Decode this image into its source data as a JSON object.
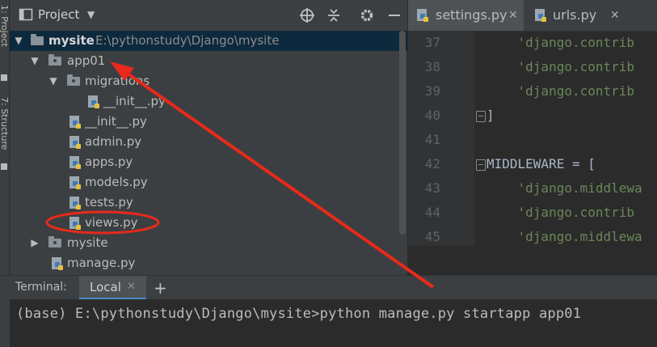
{
  "side_strip": {
    "tab_top": "1: Project",
    "tab_bottom": "7: Structure"
  },
  "project_panel": {
    "title": "Project",
    "header_icons": [
      "crosshair-icon",
      "collapse-icon",
      "gear-icon",
      "minimize-icon"
    ],
    "tree": [
      {
        "label": "mysite",
        "path": "E:\\pythonstudy\\Django\\mysite",
        "type": "folder",
        "expanded": true,
        "depth": 0
      },
      {
        "label": "app01",
        "type": "folder",
        "expanded": true,
        "depth": 1
      },
      {
        "label": "migrations",
        "type": "folder",
        "expanded": true,
        "depth": 2
      },
      {
        "label": "__init__.py",
        "type": "python-file",
        "depth": 3
      },
      {
        "label": "__init__.py",
        "type": "python-file",
        "depth": 2
      },
      {
        "label": "admin.py",
        "type": "python-file",
        "depth": 2
      },
      {
        "label": "apps.py",
        "type": "python-file",
        "depth": 2
      },
      {
        "label": "models.py",
        "type": "python-file",
        "depth": 2
      },
      {
        "label": "tests.py",
        "type": "python-file",
        "depth": 2
      },
      {
        "label": "views.py",
        "type": "python-file",
        "depth": 2
      },
      {
        "label": "mysite",
        "type": "folder",
        "expanded": false,
        "depth": 1
      },
      {
        "label": "manage.py",
        "type": "python-file",
        "depth": 1
      }
    ]
  },
  "editor": {
    "tabs": [
      {
        "label": "settings.py",
        "active": true
      },
      {
        "label": "urls.py",
        "active": false
      }
    ],
    "lines": [
      {
        "number": "37",
        "text": "    'django.contrib"
      },
      {
        "number": "38",
        "text": "    'django.contrib"
      },
      {
        "number": "39",
        "text": "    'django.contrib"
      },
      {
        "number": "40",
        "text": "]"
      },
      {
        "number": "41",
        "text": ""
      },
      {
        "number": "42",
        "text": "MIDDLEWARE = ["
      },
      {
        "number": "43",
        "text": "    'django.middlewa"
      },
      {
        "number": "44",
        "text": "    'django.contrib"
      },
      {
        "number": "45",
        "text": "    'django.middlewa"
      }
    ]
  },
  "terminal": {
    "label": "Terminal:",
    "tab": "Local",
    "command_line": "(base) E:\\pythonstudy\\Django\\mysite>python manage.py startapp app01"
  },
  "colors": {
    "annotation": "#e8291c",
    "selection": "#0d293e",
    "string": "#6a8759",
    "code": "#a9b7c6"
  }
}
